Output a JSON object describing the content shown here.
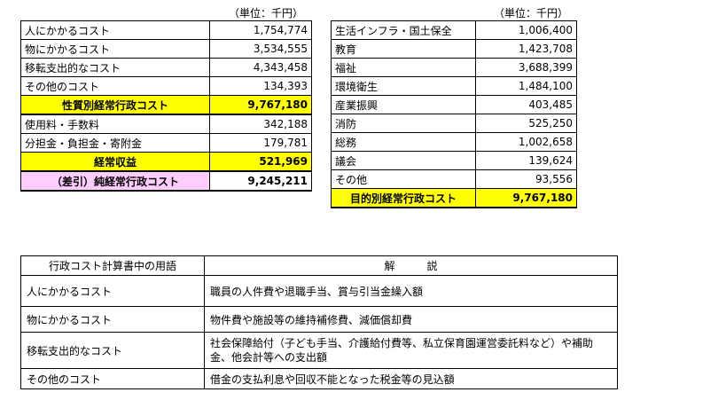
{
  "left_table": {
    "unit": "（単位：千円）",
    "rows_a": [
      {
        "label": "人にかかるコスト",
        "value": "1,754,774"
      },
      {
        "label": "物にかかるコスト",
        "value": "3,534,555"
      },
      {
        "label": "移転支出的なコスト",
        "value": "4,343,458"
      },
      {
        "label": "その他のコスト",
        "value": "134,393"
      }
    ],
    "subtotal": {
      "label": "性質別経常行政コスト",
      "value": "9,767,180"
    },
    "rows_b": [
      {
        "label": "使用料・手数料",
        "value": "342,188"
      },
      {
        "label": "分担金・負担金・寄附金",
        "value": "179,781"
      }
    ],
    "income": {
      "label": "経常収益",
      "value": "521,969"
    },
    "net": {
      "label": "（差引）純経常行政コスト",
      "value": "9,245,211"
    }
  },
  "right_table": {
    "unit": "（単位：千円）",
    "rows": [
      {
        "label": "生活インフラ・国土保全",
        "value": "1,006,400"
      },
      {
        "label": "教育",
        "value": "1,423,708"
      },
      {
        "label": "福祉",
        "value": "3,688,399"
      },
      {
        "label": "環境衛生",
        "value": "1,484,100"
      },
      {
        "label": "産業振興",
        "value": "403,485"
      },
      {
        "label": "消防",
        "value": "525,250"
      },
      {
        "label": "総務",
        "value": "1,002,658"
      },
      {
        "label": "議会",
        "value": "139,624"
      },
      {
        "label": "その他",
        "value": "93,556"
      }
    ],
    "total": {
      "label": "目的別経常行政コスト",
      "value": "9,767,180"
    }
  },
  "terms_table": {
    "header": {
      "term": "行政コスト計算書中の用語",
      "desc": "解　　　説"
    },
    "rows": [
      {
        "term": "人にかかるコスト",
        "desc": "職員の人件費や退職手当、賞与引当金繰入額"
      },
      {
        "term": "物にかかるコスト",
        "desc": "物件費や施設等の維持補修費、減価償却費"
      },
      {
        "term": "移転支出的なコスト",
        "desc": "社会保障給付（子ども手当、介護給付費等、私立保育園運営委託料など）や補助金、他会計等への支出額"
      },
      {
        "term": "その他のコスト",
        "desc": "借金の支払利息や回収不能となった税金等の見込額"
      }
    ]
  }
}
